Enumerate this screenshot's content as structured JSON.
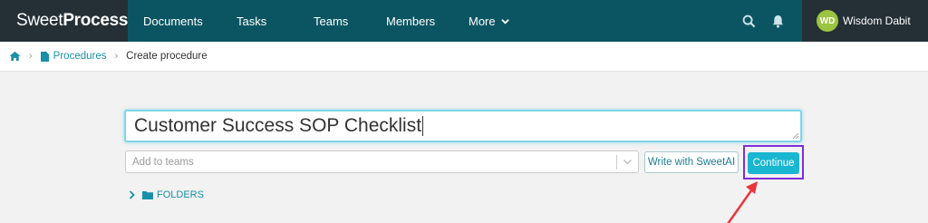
{
  "brand": {
    "name_part1": "Sweet",
    "name_part2": "Process"
  },
  "nav": {
    "items": [
      {
        "label": "Documents"
      },
      {
        "label": "Tasks"
      },
      {
        "label": "Teams"
      },
      {
        "label": "Members"
      },
      {
        "label": "More"
      }
    ]
  },
  "user": {
    "initials": "WD",
    "name": "Wisdom Dabit"
  },
  "breadcrumb": {
    "procedures": "Procedures",
    "current": "Create procedure"
  },
  "form": {
    "title_value": "Customer Success SOP Checklist",
    "teams_placeholder": "Add to teams",
    "sweetai_label": "Write with SweetAI",
    "continue_label": "Continue",
    "folders_label": "FOLDERS"
  },
  "colors": {
    "topbar": "#0b5563",
    "brand_bg": "#243036",
    "accent": "#19b6d1",
    "highlight": "#7e2ed6",
    "arrow": "#e8363c"
  },
  "icons": [
    "logo-icon",
    "search-icon",
    "bell-icon",
    "home-icon",
    "document-icon",
    "chevron-right-icon",
    "chevron-down-icon",
    "folder-icon",
    "arrow-annotation"
  ]
}
